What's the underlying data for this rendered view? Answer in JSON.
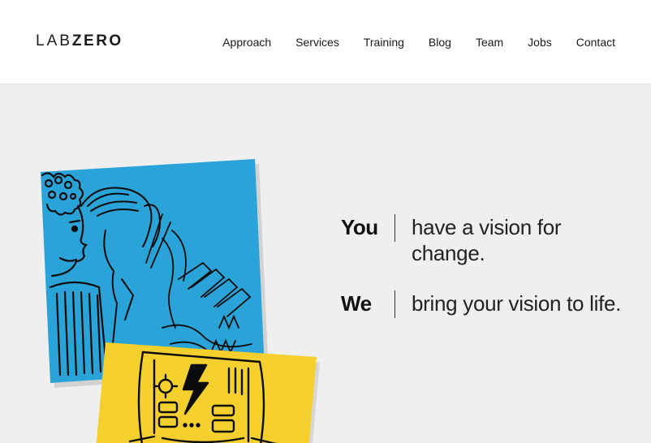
{
  "brand": {
    "logo_light": "LAB",
    "logo_bold": "ZERO"
  },
  "nav": {
    "items": [
      {
        "label": "Approach"
      },
      {
        "label": "Services"
      },
      {
        "label": "Training"
      },
      {
        "label": "Blog"
      },
      {
        "label": "Team"
      },
      {
        "label": "Jobs"
      },
      {
        "label": "Contact"
      }
    ]
  },
  "hero": {
    "rows": [
      {
        "subject": "You",
        "text": "have a vision for change."
      },
      {
        "subject": "We",
        "text": "bring your vision to life."
      }
    ]
  },
  "colors": {
    "blue_note": "#2aa3d8",
    "yellow_note": "#f5cf2e",
    "background": "#efefef"
  }
}
